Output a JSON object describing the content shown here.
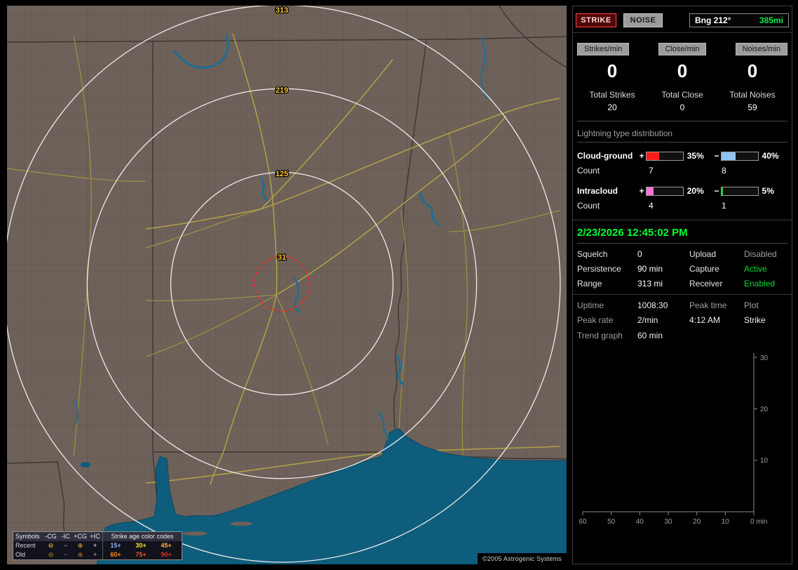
{
  "app": {
    "copyright": "©2005 Astrogenic Systems"
  },
  "colors": {
    "land": "#6d6159",
    "water": "#0f5d7c",
    "roads": "#a09142",
    "range_rings": "#ececec",
    "alarm_ring": "#ff2424",
    "ring_label": "#ffc832",
    "strike_button_border": "#ff4444",
    "green_value": "#00dd33",
    "time_green": "#00ff33",
    "cg_plus_bar": "#ff1c1c",
    "cg_minus_bar": "#8fc3f2",
    "ic_plus_bar": "#ff74dc",
    "ic_minus_bar": "#2ecc40"
  },
  "map": {
    "ring_labels": [
      "313",
      "219",
      "125",
      "31"
    ],
    "legend": {
      "symbols_header": "Symbols",
      "symbol_cols": [
        "-CG",
        "-IC",
        "+CG",
        "+IC"
      ],
      "symbol_glyphs": [
        "⊖",
        "−",
        "⊕",
        "+"
      ],
      "age_header": "Strike age color codes",
      "rows": [
        {
          "label": "Recent",
          "ages": [
            "15+",
            "30+",
            "45+"
          ]
        },
        {
          "label": "Old",
          "ages": [
            "60+",
            "75+",
            "90+"
          ]
        }
      ]
    }
  },
  "toolbar": {
    "strike_label": "STRIKE",
    "noise_label": "NOISE",
    "bearing_label": "Bng 212°",
    "bearing_distance": "385mi"
  },
  "rates": {
    "items": [
      {
        "label": "Strikes/min",
        "value": "0",
        "total_label": "Total Strikes",
        "total": "20"
      },
      {
        "label": "Close/min",
        "value": "0",
        "total_label": "Total Close",
        "total": "0"
      },
      {
        "label": "Noises/min",
        "value": "0",
        "total_label": "Total Noises",
        "total": "59"
      }
    ]
  },
  "distribution": {
    "title": "Lightning type distribution",
    "plus_sign": "+",
    "minus_sign": "−",
    "count_label": "Count",
    "rows": [
      {
        "label": "Cloud-ground",
        "plus_pct": "35%",
        "plus_fill": 35,
        "minus_pct": "40%",
        "minus_fill": 40,
        "plus_count": "7",
        "minus_count": "8"
      },
      {
        "label": "Intracloud",
        "plus_pct": "20%",
        "plus_fill": 20,
        "minus_pct": "5%",
        "minus_fill": 5,
        "plus_count": "4",
        "minus_count": "1"
      }
    ]
  },
  "clock": {
    "datetime": "2/23/2026 12:45:02 PM"
  },
  "settings": {
    "rows": [
      {
        "l1": "Squelch",
        "v1": "0",
        "l2": "Upload",
        "v2": "Disabled"
      },
      {
        "l1": "Persistence",
        "v1": "90 min",
        "l2": "Capture",
        "v2": "Active"
      },
      {
        "l1": "Range",
        "v1": "313 mi",
        "l2": "Receiver",
        "v2": "Enabled"
      }
    ]
  },
  "status": {
    "uptime_label": "Uptime",
    "uptime": "1008:30",
    "peak_time_label": "Peak time",
    "plot_label": "Plot",
    "peak_rate_label": "Peak rate",
    "peak_rate": "2/min",
    "peak_time": "4:12 AM",
    "plot_type": "Strike",
    "trend_label": "Trend graph",
    "trend_window": "60 min"
  },
  "trend": {
    "y_ticks": [
      "30",
      "20",
      "10"
    ],
    "x_ticks": [
      "60",
      "50",
      "40",
      "30",
      "20",
      "10"
    ],
    "x_end": "0 min",
    "series": []
  }
}
